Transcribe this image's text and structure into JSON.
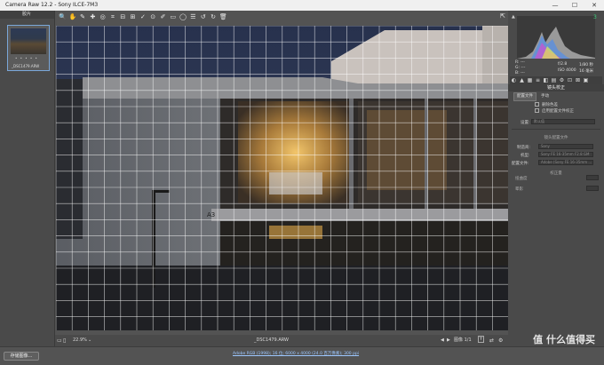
{
  "window": {
    "title": "Camera Raw 12.2 - Sony ILCE-7M3",
    "minimize": "—",
    "maximize": "☐",
    "close": "✕"
  },
  "filmstrip": {
    "title": "胶片",
    "thumb_stars": "• • • • •",
    "thumb_name": "_DSC1479.ARW"
  },
  "toolbar": {
    "tools": [
      "zoom-icon",
      "hand-icon",
      "white-balance-icon",
      "color-sampler-icon",
      "targeted-adjustment-icon",
      "crop-icon",
      "straighten-icon",
      "transform-icon",
      "spot-removal-icon",
      "red-eye-icon",
      "adjustment-brush-icon",
      "graduated-filter-icon",
      "radial-filter-icon",
      "preferences-icon",
      "rotate-ccw-icon",
      "rotate-cw-icon",
      "trash-icon"
    ],
    "glyphs": [
      "🔍",
      "✋",
      "✎",
      "✚",
      "◎",
      "⌗",
      "⊟",
      "⊞",
      "✓",
      "⊙",
      "✐",
      "▭",
      "◯",
      "☰",
      "↺",
      "↻",
      "🗑"
    ],
    "fullscreen_glyph": "⇱"
  },
  "histogram": {
    "clip_left": "▲",
    "clip_right": "3"
  },
  "exif": {
    "r_label": "R:",
    "r_val": "---",
    "g_label": "G:",
    "g_val": "---",
    "b_label": "B:",
    "b_val": "---",
    "aperture": "f/2.8",
    "shutter": "1/80 秒",
    "iso": "ISO 4000",
    "focal": "16 毫米"
  },
  "panel_tabs": [
    "◐",
    "▲",
    "▦",
    "≡",
    "◧",
    "▤",
    "⚙",
    "⊡",
    "⊠",
    "▣"
  ],
  "panel": {
    "title": "镜头校正",
    "tab_profile": "配置文件",
    "tab_manual": "手动",
    "chk_remove_ca": "删除色差",
    "chk_enable_profile": "启用配置文件校正",
    "setup_label": "设置:",
    "setup_value": "默认值",
    "section_lens_profile": "镜头配置文件",
    "maker_label": "制造商:",
    "maker_value": "Sony",
    "model_label": "机型:",
    "model_value": "Sony FE 16-35mm F2.8 GM",
    "profile_label": "配置文件:",
    "profile_value": "Adobe (Sony FE 16-35mm ...",
    "section_amount": "校正量",
    "distortion_label": "扭曲度",
    "vignette_label": "晕影"
  },
  "status": {
    "zoom": "22.9%",
    "filename": "_DSC1479.ARW",
    "image_count": "图像 1/1"
  },
  "bottom": {
    "save_button": "存储图像...",
    "workflow": "Adobe RGB (1998); 16 位; 6000 x 4000 (24.0 百万像素); 300 ppi",
    "watermark": "值 什么值得买"
  },
  "colors": {
    "accent": "#5aa9ff",
    "grid": "#ffffff"
  }
}
